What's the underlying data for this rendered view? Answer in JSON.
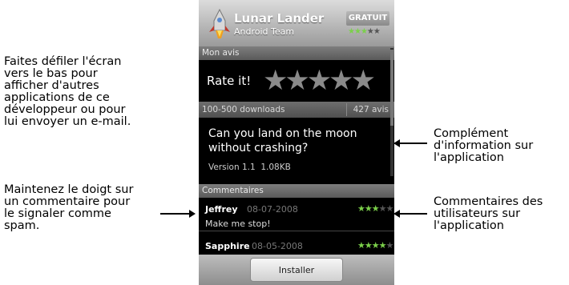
{
  "callouts": {
    "top_left": [
      "Faites défiler l'écran",
      "vers le bas pour",
      "afficher d'autres",
      "applications de ce",
      "développeur ou pour",
      "lui envoyer un e-mail."
    ],
    "bottom_left": [
      "Maintenez le doigt sur",
      "un commentaire pour",
      "le signaler comme",
      "spam."
    ],
    "top_right": [
      "Complément",
      "d'information sur",
      "l'application"
    ],
    "bottom_right": [
      "Commentaires des",
      "utilisateurs sur",
      "l'application"
    ]
  },
  "app": {
    "title": "Lunar Lander",
    "developer": "Android Team",
    "price": "GRATUIT",
    "rating_stars": 3
  },
  "my_review": {
    "section_label": "Mon avis",
    "rate_label": "Rate it!",
    "stars": 5
  },
  "downloads": {
    "range": "100-500 downloads",
    "reviews_count": "427 avis"
  },
  "description": {
    "line1": "Can you land on the moon",
    "line2": "without crashing?",
    "version": "Version 1.1",
    "size": "1.08KB"
  },
  "comments": {
    "section_label": "Commentaires",
    "items": [
      {
        "name": "Jeffrey",
        "date": "08-07-2008",
        "text": "Make me stop!",
        "stars": 3
      },
      {
        "name": "Sapphire",
        "date": "08-05-2008",
        "text": "",
        "stars": 4
      }
    ]
  },
  "install_button": "Installer",
  "colors": {
    "star_green": "#7bd04a",
    "star_gray": "#8a8a8a"
  }
}
